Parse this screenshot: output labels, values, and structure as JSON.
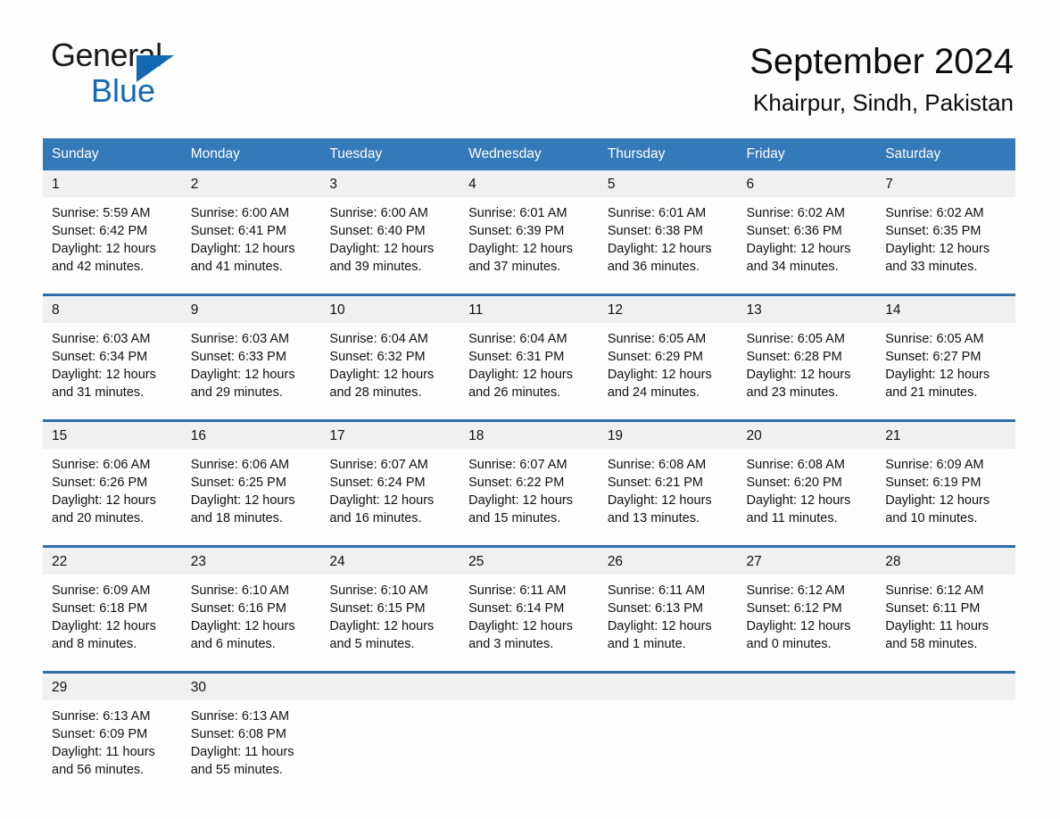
{
  "brand": {
    "name_dark": "General",
    "name_light": "Blue",
    "triangle_icon": "triangle-icon",
    "accent_color": "#1268b3"
  },
  "header": {
    "month_title": "September 2024",
    "location": "Khairpur, Sindh, Pakistan"
  },
  "calendar": {
    "header_bg_color": "#3479b8",
    "daynum_bg_color": "#f0f0f0",
    "separator_color": "#2e6fa8",
    "weekday_headers": [
      "Sunday",
      "Monday",
      "Tuesday",
      "Wednesday",
      "Thursday",
      "Friday",
      "Saturday"
    ],
    "weeks": [
      [
        {
          "day": "1",
          "sunrise": "Sunrise: 5:59 AM",
          "sunset": "Sunset: 6:42 PM",
          "daylight_line1": "Daylight: 12 hours",
          "daylight_line2": "and 42 minutes."
        },
        {
          "day": "2",
          "sunrise": "Sunrise: 6:00 AM",
          "sunset": "Sunset: 6:41 PM",
          "daylight_line1": "Daylight: 12 hours",
          "daylight_line2": "and 41 minutes."
        },
        {
          "day": "3",
          "sunrise": "Sunrise: 6:00 AM",
          "sunset": "Sunset: 6:40 PM",
          "daylight_line1": "Daylight: 12 hours",
          "daylight_line2": "and 39 minutes."
        },
        {
          "day": "4",
          "sunrise": "Sunrise: 6:01 AM",
          "sunset": "Sunset: 6:39 PM",
          "daylight_line1": "Daylight: 12 hours",
          "daylight_line2": "and 37 minutes."
        },
        {
          "day": "5",
          "sunrise": "Sunrise: 6:01 AM",
          "sunset": "Sunset: 6:38 PM",
          "daylight_line1": "Daylight: 12 hours",
          "daylight_line2": "and 36 minutes."
        },
        {
          "day": "6",
          "sunrise": "Sunrise: 6:02 AM",
          "sunset": "Sunset: 6:36 PM",
          "daylight_line1": "Daylight: 12 hours",
          "daylight_line2": "and 34 minutes."
        },
        {
          "day": "7",
          "sunrise": "Sunrise: 6:02 AM",
          "sunset": "Sunset: 6:35 PM",
          "daylight_line1": "Daylight: 12 hours",
          "daylight_line2": "and 33 minutes."
        }
      ],
      [
        {
          "day": "8",
          "sunrise": "Sunrise: 6:03 AM",
          "sunset": "Sunset: 6:34 PM",
          "daylight_line1": "Daylight: 12 hours",
          "daylight_line2": "and 31 minutes."
        },
        {
          "day": "9",
          "sunrise": "Sunrise: 6:03 AM",
          "sunset": "Sunset: 6:33 PM",
          "daylight_line1": "Daylight: 12 hours",
          "daylight_line2": "and 29 minutes."
        },
        {
          "day": "10",
          "sunrise": "Sunrise: 6:04 AM",
          "sunset": "Sunset: 6:32 PM",
          "daylight_line1": "Daylight: 12 hours",
          "daylight_line2": "and 28 minutes."
        },
        {
          "day": "11",
          "sunrise": "Sunrise: 6:04 AM",
          "sunset": "Sunset: 6:31 PM",
          "daylight_line1": "Daylight: 12 hours",
          "daylight_line2": "and 26 minutes."
        },
        {
          "day": "12",
          "sunrise": "Sunrise: 6:05 AM",
          "sunset": "Sunset: 6:29 PM",
          "daylight_line1": "Daylight: 12 hours",
          "daylight_line2": "and 24 minutes."
        },
        {
          "day": "13",
          "sunrise": "Sunrise: 6:05 AM",
          "sunset": "Sunset: 6:28 PM",
          "daylight_line1": "Daylight: 12 hours",
          "daylight_line2": "and 23 minutes."
        },
        {
          "day": "14",
          "sunrise": "Sunrise: 6:05 AM",
          "sunset": "Sunset: 6:27 PM",
          "daylight_line1": "Daylight: 12 hours",
          "daylight_line2": "and 21 minutes."
        }
      ],
      [
        {
          "day": "15",
          "sunrise": "Sunrise: 6:06 AM",
          "sunset": "Sunset: 6:26 PM",
          "daylight_line1": "Daylight: 12 hours",
          "daylight_line2": "and 20 minutes."
        },
        {
          "day": "16",
          "sunrise": "Sunrise: 6:06 AM",
          "sunset": "Sunset: 6:25 PM",
          "daylight_line1": "Daylight: 12 hours",
          "daylight_line2": "and 18 minutes."
        },
        {
          "day": "17",
          "sunrise": "Sunrise: 6:07 AM",
          "sunset": "Sunset: 6:24 PM",
          "daylight_line1": "Daylight: 12 hours",
          "daylight_line2": "and 16 minutes."
        },
        {
          "day": "18",
          "sunrise": "Sunrise: 6:07 AM",
          "sunset": "Sunset: 6:22 PM",
          "daylight_line1": "Daylight: 12 hours",
          "daylight_line2": "and 15 minutes."
        },
        {
          "day": "19",
          "sunrise": "Sunrise: 6:08 AM",
          "sunset": "Sunset: 6:21 PM",
          "daylight_line1": "Daylight: 12 hours",
          "daylight_line2": "and 13 minutes."
        },
        {
          "day": "20",
          "sunrise": "Sunrise: 6:08 AM",
          "sunset": "Sunset: 6:20 PM",
          "daylight_line1": "Daylight: 12 hours",
          "daylight_line2": "and 11 minutes."
        },
        {
          "day": "21",
          "sunrise": "Sunrise: 6:09 AM",
          "sunset": "Sunset: 6:19 PM",
          "daylight_line1": "Daylight: 12 hours",
          "daylight_line2": "and 10 minutes."
        }
      ],
      [
        {
          "day": "22",
          "sunrise": "Sunrise: 6:09 AM",
          "sunset": "Sunset: 6:18 PM",
          "daylight_line1": "Daylight: 12 hours",
          "daylight_line2": "and 8 minutes."
        },
        {
          "day": "23",
          "sunrise": "Sunrise: 6:10 AM",
          "sunset": "Sunset: 6:16 PM",
          "daylight_line1": "Daylight: 12 hours",
          "daylight_line2": "and 6 minutes."
        },
        {
          "day": "24",
          "sunrise": "Sunrise: 6:10 AM",
          "sunset": "Sunset: 6:15 PM",
          "daylight_line1": "Daylight: 12 hours",
          "daylight_line2": "and 5 minutes."
        },
        {
          "day": "25",
          "sunrise": "Sunrise: 6:11 AM",
          "sunset": "Sunset: 6:14 PM",
          "daylight_line1": "Daylight: 12 hours",
          "daylight_line2": "and 3 minutes."
        },
        {
          "day": "26",
          "sunrise": "Sunrise: 6:11 AM",
          "sunset": "Sunset: 6:13 PM",
          "daylight_line1": "Daylight: 12 hours",
          "daylight_line2": "and 1 minute."
        },
        {
          "day": "27",
          "sunrise": "Sunrise: 6:12 AM",
          "sunset": "Sunset: 6:12 PM",
          "daylight_line1": "Daylight: 12 hours",
          "daylight_line2": "and 0 minutes."
        },
        {
          "day": "28",
          "sunrise": "Sunrise: 6:12 AM",
          "sunset": "Sunset: 6:11 PM",
          "daylight_line1": "Daylight: 11 hours",
          "daylight_line2": "and 58 minutes."
        }
      ],
      [
        {
          "day": "29",
          "sunrise": "Sunrise: 6:13 AM",
          "sunset": "Sunset: 6:09 PM",
          "daylight_line1": "Daylight: 11 hours",
          "daylight_line2": "and 56 minutes."
        },
        {
          "day": "30",
          "sunrise": "Sunrise: 6:13 AM",
          "sunset": "Sunset: 6:08 PM",
          "daylight_line1": "Daylight: 11 hours",
          "daylight_line2": "and 55 minutes."
        },
        {
          "day": "",
          "sunrise": "",
          "sunset": "",
          "daylight_line1": "",
          "daylight_line2": ""
        },
        {
          "day": "",
          "sunrise": "",
          "sunset": "",
          "daylight_line1": "",
          "daylight_line2": ""
        },
        {
          "day": "",
          "sunrise": "",
          "sunset": "",
          "daylight_line1": "",
          "daylight_line2": ""
        },
        {
          "day": "",
          "sunrise": "",
          "sunset": "",
          "daylight_line1": "",
          "daylight_line2": ""
        },
        {
          "day": "",
          "sunrise": "",
          "sunset": "",
          "daylight_line1": "",
          "daylight_line2": ""
        }
      ]
    ]
  }
}
